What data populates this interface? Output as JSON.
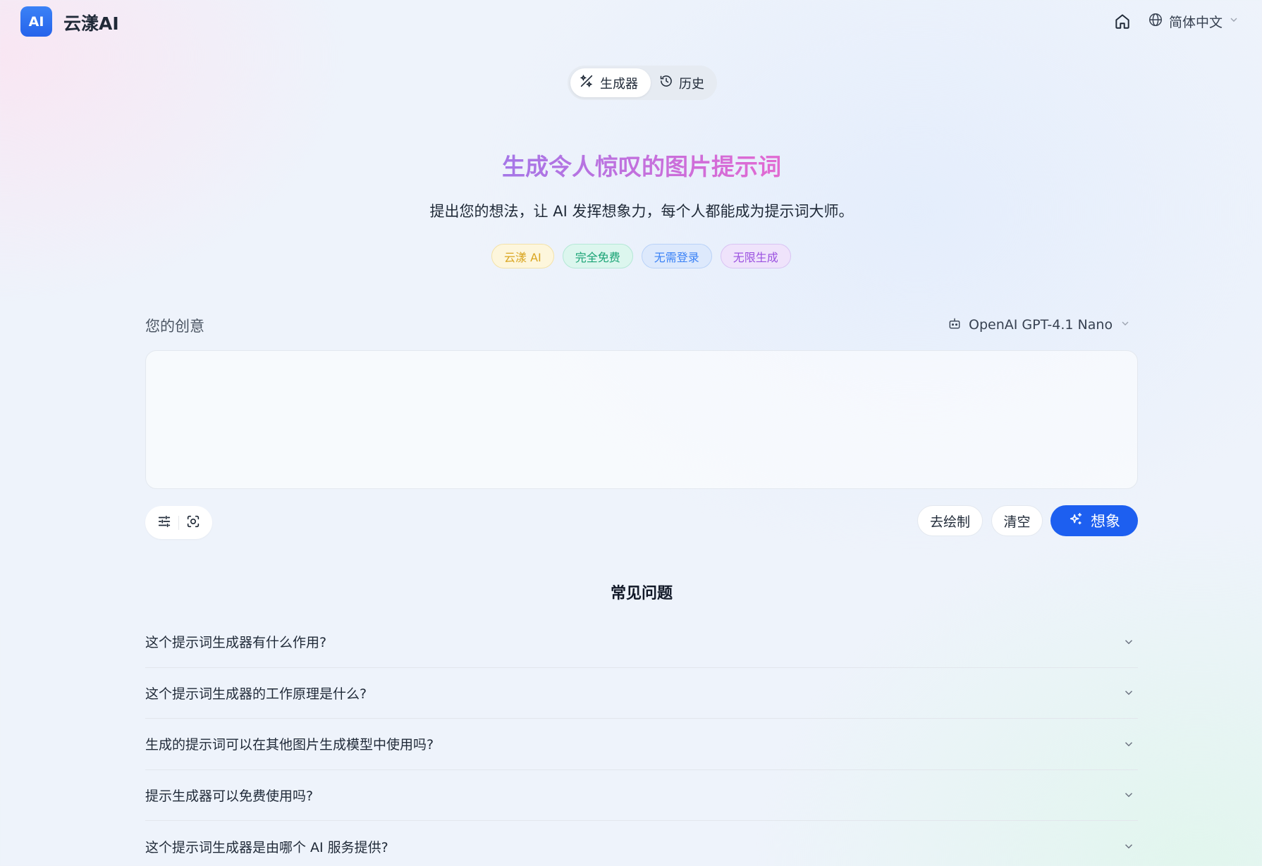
{
  "header": {
    "logo_text": "AI",
    "brand": "云漾AI",
    "language": "简体中文"
  },
  "tabs": [
    {
      "label": "生成器",
      "icon": "magic-wand-icon",
      "active": true
    },
    {
      "label": "历史",
      "icon": "history-icon",
      "active": false
    }
  ],
  "hero": {
    "title": "生成令人惊叹的图片提示词",
    "subtitle": "提出您的想法，让 AI 发挥想象力，每个人都能成为提示词大师。",
    "badges": [
      "云漾 AI",
      "完全免费",
      "无需登录",
      "无限生成"
    ]
  },
  "creative": {
    "label": "您的创意",
    "model": "OpenAI GPT-4.1 Nano",
    "input_value": "",
    "draw_button": "去绘制",
    "clear_button": "清空",
    "imagine_button": "想象"
  },
  "faq": {
    "title": "常见问题",
    "items": [
      "这个提示词生成器有什么作用?",
      "这个提示词生成器的工作原理是什么?",
      "生成的提示词可以在其他图片生成模型中使用吗?",
      "提示生成器可以免费使用吗?",
      "这个提示词生成器是由哪个 AI 服务提供?"
    ]
  },
  "colors": {
    "primary": "#1d5ff0",
    "logo": "#2f6ff5"
  }
}
